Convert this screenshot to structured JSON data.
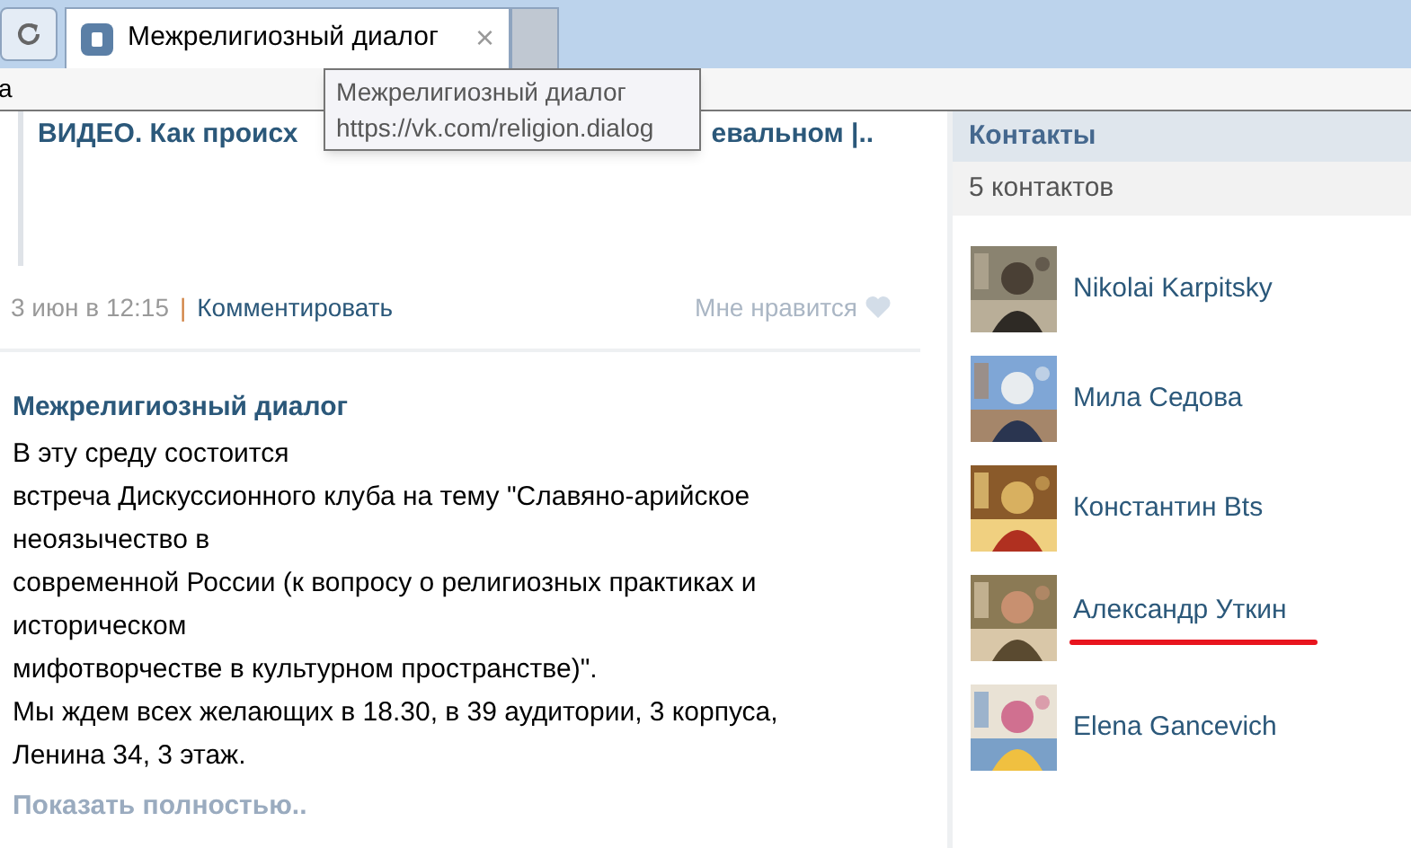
{
  "browser": {
    "tab": {
      "title": "Межрелигиозный диалог",
      "close": "×"
    },
    "address_fragment": "а",
    "tooltip": {
      "title": "Межрелигиозный диалог",
      "url": "https://vk.com/religion.dialog"
    }
  },
  "feed": {
    "prev_post": {
      "title_start": "ВИДЕО. Как происх",
      "title_end": "евальном |..",
      "date": "3 июн в 12:15",
      "separator": "|",
      "comment": "Комментировать",
      "like": "Мне нравится"
    },
    "post": {
      "author": "Межрелигиозный диалог",
      "lines": [
        "В эту среду состоится",
        "встреча Дискуссионного клуба на тему \"Славяно-арийское",
        "неоязычество в",
        "современной России (к вопросу о религиозных практиках и",
        "историческом",
        "мифотворчестве в культурном пространстве)\".",
        "Мы ждем всех желающих в 18.30, в 39 аудитории, 3 корпуса,",
        "Ленина 34, 3 этаж."
      ],
      "show_more": "Показать полностью.."
    }
  },
  "contacts": {
    "title": "Контакты",
    "count": "5 контактов",
    "items": [
      {
        "name": "Nikolai Karpitsky",
        "underlined": false
      },
      {
        "name": "Мила Седова",
        "underlined": false
      },
      {
        "name": "Константин Bts",
        "underlined": false
      },
      {
        "name": "Александр Уткин",
        "underlined": true
      },
      {
        "name": "Elena Gancevich",
        "underlined": false
      }
    ]
  }
}
